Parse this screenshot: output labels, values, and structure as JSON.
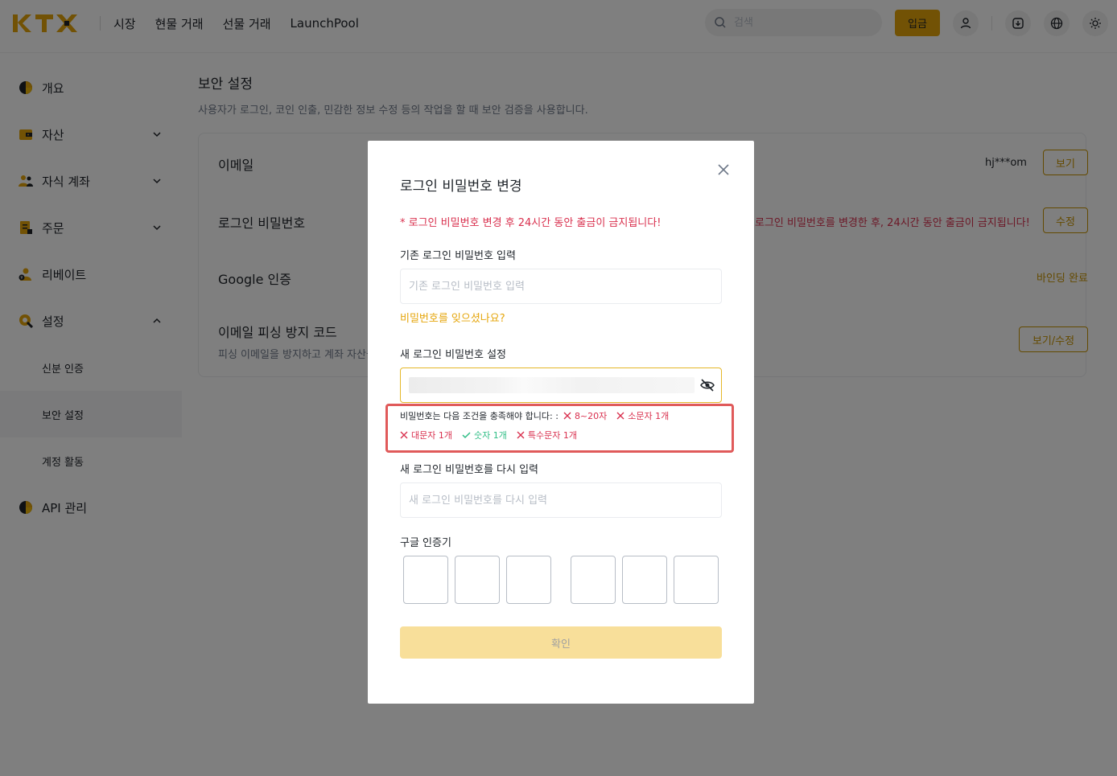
{
  "header": {
    "logo_text": "KTX",
    "nav": [
      "시장",
      "현물 거래",
      "선물 거래",
      "LaunchPool"
    ],
    "search_placeholder": "검색",
    "deposit_label": "입금"
  },
  "sidebar": {
    "items": [
      {
        "label": "개요",
        "icon": "overview-pie-icon"
      },
      {
        "label": "자산",
        "icon": "wallet-icon"
      },
      {
        "label": "자식 계좌",
        "icon": "sub-account-icon"
      },
      {
        "label": "주문",
        "icon": "orders-icon"
      },
      {
        "label": "리베이트",
        "icon": "rebate-icon"
      },
      {
        "label": "설정",
        "icon": "settings-icon"
      }
    ],
    "sub_items": [
      "신분 인증",
      "보안 설정",
      "계정 활동"
    ],
    "api_label": "API 관리"
  },
  "main": {
    "title": "보안 설정",
    "description": "사용자가 로그인, 코인 인출, 민감한 정보 수정 등의 작업을 할 때 보안 검증을 사용합니다.",
    "rows": {
      "email": {
        "title": "이메일",
        "value": "hj***om",
        "button": "보기"
      },
      "password": {
        "title": "로그인 비밀번호",
        "warning": "로그인 비밀번호를 변경한 후, 24시간 동안 출금이 금지됩니다!",
        "button": "수정"
      },
      "google": {
        "title": "Google 인증",
        "status": "바인딩 완료"
      },
      "antiphishing": {
        "title": "이메일 피싱 방지 코드",
        "subtitle": "피싱 이메일을 방지하고 계좌 자산을",
        "button": "보기/수정"
      }
    }
  },
  "modal": {
    "title": "로그인 비밀번호 변경",
    "warning": "* 로그인 비밀번호 변경 후 24시간 동안 출금이 금지됩니다!",
    "old_label": "기존 로그인 비밀번호 입력",
    "old_placeholder": "기존 로그인 비밀번호 입력",
    "forgot": "비밀번호를 잊으셨나요?",
    "new_label": "새 로그인 비밀번호 설정",
    "requirements_intro": "비밀번호는 다음 조건을 충족해야 합니다: :",
    "requirements": [
      {
        "text": "8~20자",
        "met": false
      },
      {
        "text": "소문자 1개",
        "met": false
      },
      {
        "text": "대문자 1개",
        "met": false
      },
      {
        "text": "숫자 1개",
        "met": true
      },
      {
        "text": "특수문자 1개",
        "met": false
      }
    ],
    "confirm_label": "새 로그인 비밀번호를 다시 입력",
    "confirm_placeholder": "새 로그인 비밀번호를 다시 입력",
    "google_label": "구글 인증기",
    "submit": "확인"
  },
  "colors": {
    "accent": "#e5a50a",
    "danger": "#d9304e",
    "success": "#2ebd85",
    "highlight_box": "#e05a5a"
  }
}
